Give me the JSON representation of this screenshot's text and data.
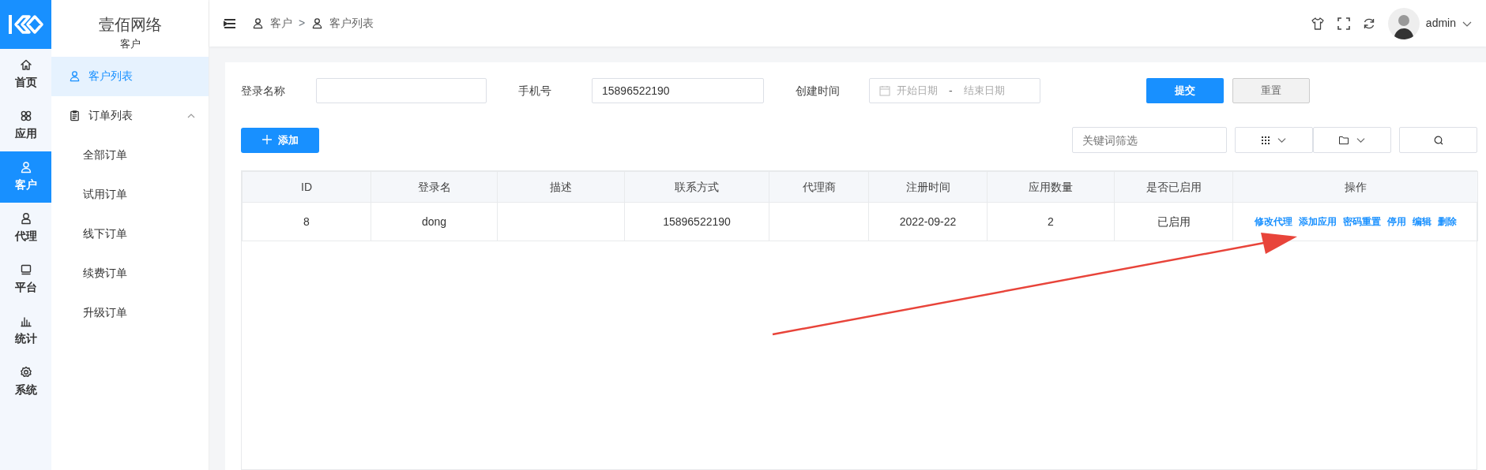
{
  "rail": {
    "items": [
      {
        "label": "首页",
        "selected": false
      },
      {
        "label": "应用",
        "selected": false
      },
      {
        "label": "客户",
        "selected": true
      },
      {
        "label": "代理",
        "selected": false
      },
      {
        "label": "平台",
        "selected": false
      },
      {
        "label": "统计",
        "selected": false
      },
      {
        "label": "系统",
        "selected": false
      }
    ]
  },
  "sidebar": {
    "title": "壹佰网络",
    "subtitle": "客户",
    "items": [
      {
        "label": "客户列表",
        "selected": true
      },
      {
        "label": "订单列表",
        "selected": false,
        "expanded": true,
        "children": [
          {
            "label": "全部订单",
            "selected": false
          },
          {
            "label": "试用订单",
            "selected": false
          },
          {
            "label": "线下订单",
            "selected": false
          },
          {
            "label": "续费订单",
            "selected": false
          },
          {
            "label": "升级订单",
            "selected": false
          }
        ]
      }
    ]
  },
  "breadcrumb": [
    "客户",
    "客户列表"
  ],
  "breadcrumb_separator": ">",
  "user": {
    "name": "admin"
  },
  "filters": [
    {
      "kind": "text",
      "label": "登录名称"
    },
    {
      "kind": "text",
      "label": "手机号",
      "value": "15896522190"
    },
    {
      "kind": "daterange",
      "label": "创建时间",
      "start_placeholder": "开始日期",
      "separator": "-",
      "end_placeholder": "结束日期"
    }
  ],
  "submit_button": "提交",
  "reset_button": "重置",
  "add_button": "添加",
  "keyword_search": {
    "placeholder": "关键词筛选"
  },
  "table": {
    "columns": [
      "ID",
      "登录名",
      "描述",
      "联系方式",
      "代理商",
      "注册时间",
      "应用数量",
      "是否已启用",
      "操作"
    ],
    "rows": [
      {
        "cells": [
          "8",
          "dong",
          "",
          "15896522190",
          "",
          "2022-09-22",
          "2",
          "已启用"
        ],
        "actions": [
          "修改代理",
          "添加应用",
          "密码重置",
          "停用",
          "编辑",
          "删除"
        ]
      }
    ]
  }
}
